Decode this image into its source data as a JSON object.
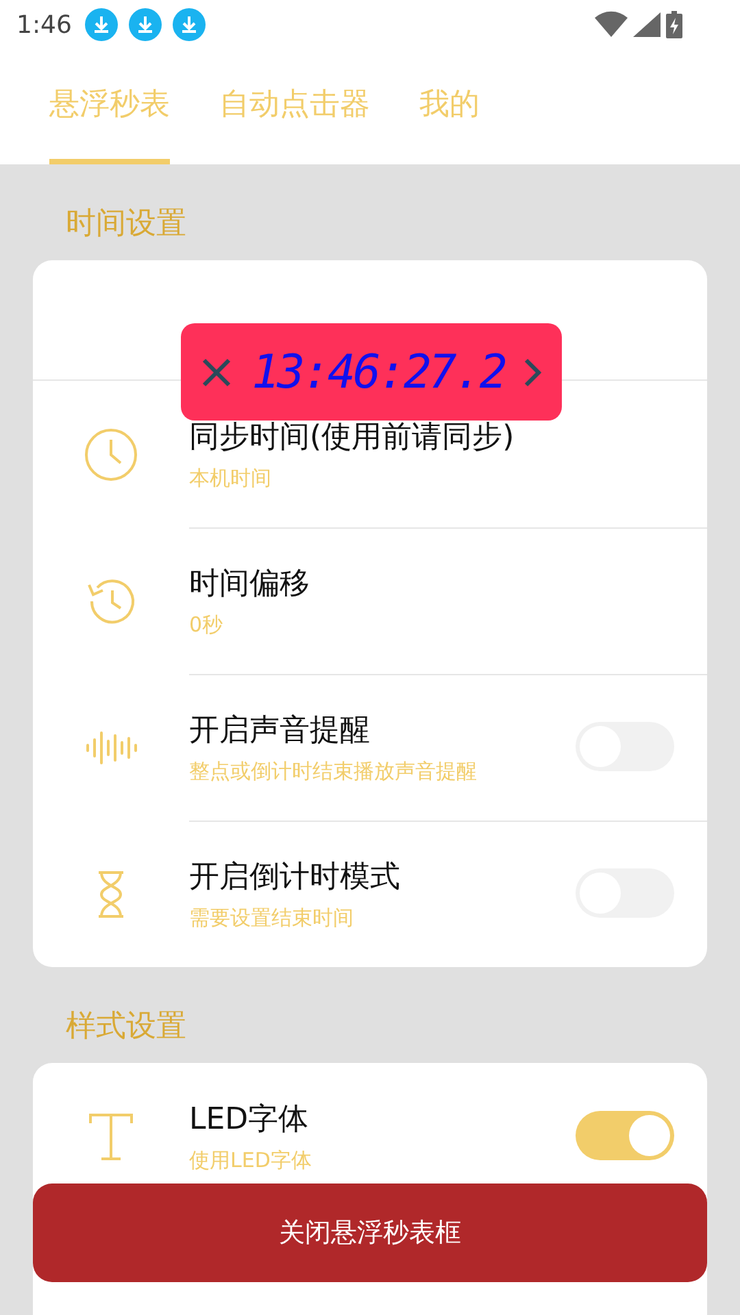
{
  "status_bar": {
    "time": "1:46"
  },
  "tabs": [
    {
      "label": "悬浮秒表",
      "selected": true
    },
    {
      "label": "自动点击器",
      "selected": false
    },
    {
      "label": "我的",
      "selected": false
    }
  ],
  "floating_clock": {
    "time": "13:46:27.2"
  },
  "sections": [
    {
      "title": "时间设置",
      "rows": [
        {
          "kind": "link",
          "title": "同步时间(使用前请同步)",
          "subtitle": "本机时间"
        },
        {
          "kind": "link",
          "title": "时间偏移",
          "subtitle": "0秒"
        },
        {
          "kind": "switch",
          "title": "开启声音提醒",
          "subtitle": "整点或倒计时结束播放声音提醒",
          "on": false
        },
        {
          "kind": "switch",
          "title": "开启倒计时模式",
          "subtitle": "需要设置结束时间",
          "on": false
        }
      ]
    },
    {
      "title": "样式设置",
      "rows": [
        {
          "kind": "switch",
          "title": "LED字体",
          "subtitle": "使用LED字体",
          "on": true
        }
      ]
    }
  ],
  "close_button": "关闭悬浮秒表框"
}
